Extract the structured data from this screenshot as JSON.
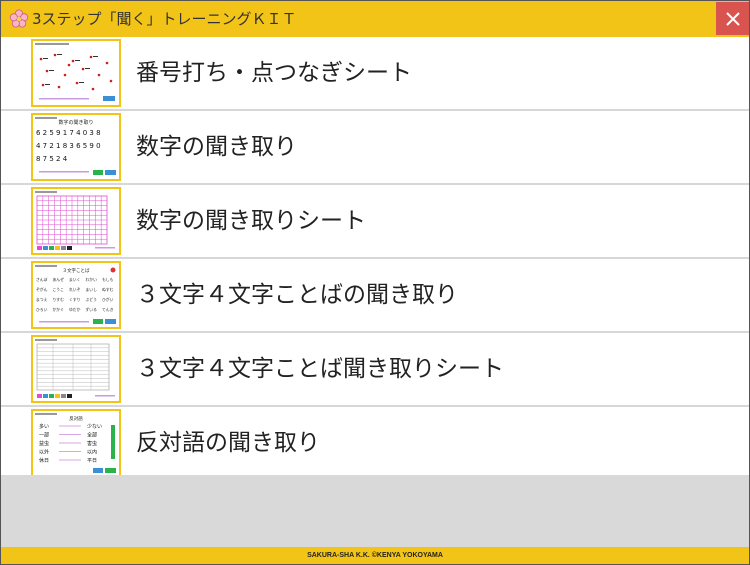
{
  "app": {
    "title": "3ステップ「聞く」トレーニングＫＩＴ",
    "icon": "cherry-blossom-icon",
    "close_icon": "close-icon"
  },
  "menu": {
    "items": [
      {
        "label": "番号打ち・点つなぎシート",
        "thumbnail": "dot-sheet"
      },
      {
        "label": "数字の聞き取り",
        "thumbnail": "number-listening"
      },
      {
        "label": "数字の聞き取りシート",
        "thumbnail": "grid-sheet"
      },
      {
        "label": "３文字４文字ことばの聞き取り",
        "thumbnail": "word-grid"
      },
      {
        "label": "３文字４文字ことば聞き取りシート",
        "thumbnail": "word-sheet"
      },
      {
        "label": "反対語の聞き取り",
        "thumbnail": "antonyms"
      }
    ]
  },
  "thumbs": {
    "number_title": "数字の聞き取り",
    "number_rows": [
      "6 2 5 9 1 7 4 0 3 8",
      "4 7 2 1 8 3 6 5 9 0",
      "8 7 5 2 4"
    ],
    "word_title": "３文字ことば",
    "words": [
      "さんぽ",
      "あんぜ",
      "まいく",
      "わかい",
      "もしも",
      "ぞがん",
      "こうこ",
      "れいぞ",
      "まいし",
      "ぬすむ",
      "まつえ",
      "りすむ",
      "くすり",
      "ぶどう",
      "ひがい",
      "ひろい",
      "かかぐ",
      "ゆだか",
      "ずいる",
      "てんき"
    ],
    "antonym_title": "反対語",
    "antonym_pairs": [
      [
        "多い",
        "少ない"
      ],
      [
        "一部",
        "全部"
      ],
      [
        "益虫",
        "害虫"
      ],
      [
        "以外",
        "以内"
      ],
      [
        "休日",
        "平日"
      ]
    ]
  },
  "footer": {
    "text": "SAKURA-SHA K.K. ©KENYA YOKOYAMA"
  },
  "colors": {
    "accent": "#f3c418",
    "close": "#d9534f",
    "grid_pink": "#e04bd0",
    "empty_area": "#d9d9d9"
  }
}
